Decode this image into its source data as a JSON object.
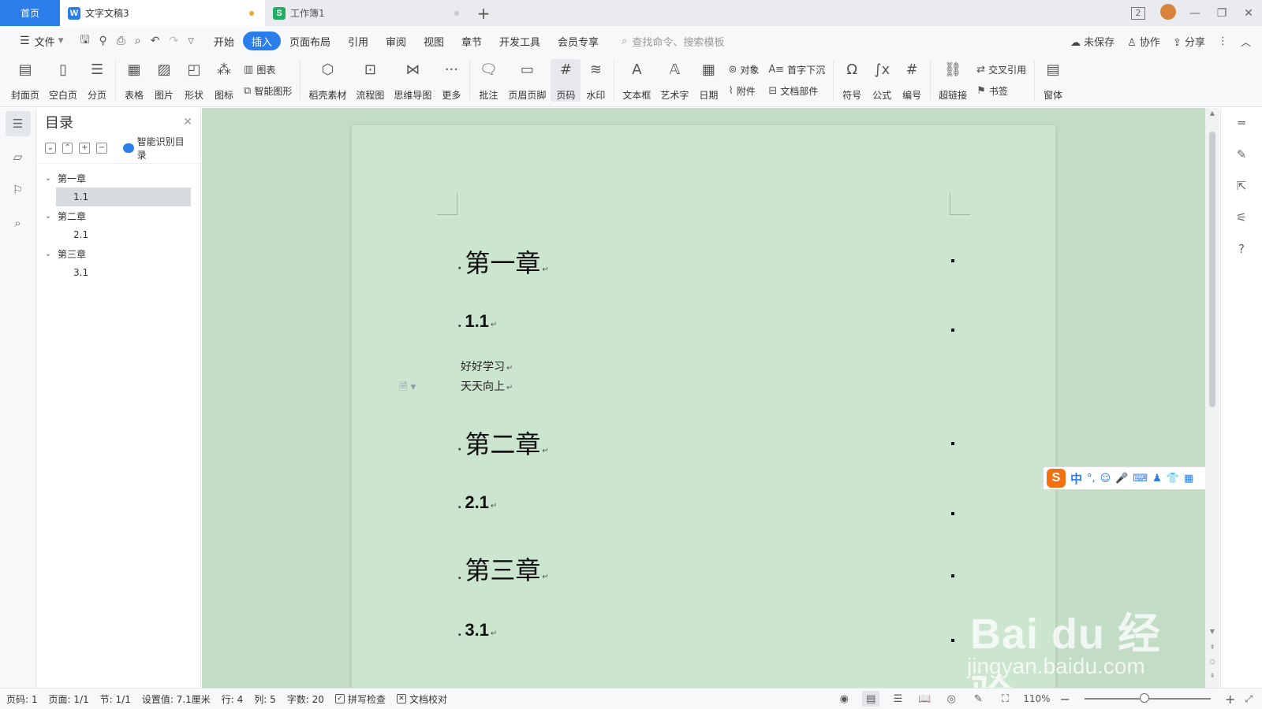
{
  "tabbar": {
    "home_label": "首页",
    "tabs": [
      {
        "title": "文字文稿3",
        "app_letter": "W",
        "app_color": "#2b7de9",
        "active": true,
        "dot_color": "#f4a62a"
      },
      {
        "title": "工作簿1",
        "app_letter": "S",
        "app_color": "#1fae63",
        "active": false,
        "dot_color": "#c8cbd0"
      }
    ],
    "new_tab": "+",
    "badge": "2"
  },
  "menubar": {
    "file_label": "文件",
    "items": [
      "开始",
      "插入",
      "页面布局",
      "引用",
      "审阅",
      "视图",
      "章节",
      "开发工具",
      "会员专享"
    ],
    "active_item": "插入",
    "search_placeholder": "查找命令、搜索模板",
    "right": {
      "unsaved": "未保存",
      "collab": "协作",
      "share": "分享"
    }
  },
  "ribbon": {
    "big": [
      {
        "label": "封面页",
        "icon": "cover-page-icon"
      },
      {
        "label": "空白页",
        "icon": "blank-page-icon"
      },
      {
        "label": "分页",
        "icon": "page-break-icon"
      },
      {
        "label": "表格",
        "icon": "table-icon"
      },
      {
        "label": "图片",
        "icon": "picture-icon"
      },
      {
        "label": "形状",
        "icon": "shape-icon"
      },
      {
        "label": "图标",
        "icon": "icons-icon"
      }
    ],
    "pair1": {
      "top": "图表",
      "bottom": "智能图形"
    },
    "big2": [
      {
        "label": "稻壳素材",
        "icon": "material-icon"
      },
      {
        "label": "流程图",
        "icon": "flowchart-icon"
      },
      {
        "label": "思维导图",
        "icon": "mindmap-icon"
      },
      {
        "label": "更多",
        "icon": "more-icon"
      },
      {
        "label": "批注",
        "icon": "comment-icon"
      },
      {
        "label": "页眉页脚",
        "icon": "header-footer-icon"
      },
      {
        "label": "页码",
        "icon": "page-number-icon"
      },
      {
        "label": "水印",
        "icon": "watermark-icon"
      },
      {
        "label": "文本框",
        "icon": "textbox-icon"
      },
      {
        "label": "艺术字",
        "icon": "wordart-icon"
      },
      {
        "label": "日期",
        "icon": "date-icon"
      }
    ],
    "pair2": {
      "top": "对象",
      "bottom": "附件"
    },
    "pair3": {
      "top": "首字下沉",
      "bottom": "文档部件"
    },
    "big3": [
      {
        "label": "符号",
        "icon": "symbol-icon"
      },
      {
        "label": "公式",
        "icon": "formula-icon"
      },
      {
        "label": "编号",
        "icon": "numbering-icon"
      },
      {
        "label": "超链接",
        "icon": "hyperlink-icon"
      }
    ],
    "pair4": {
      "top": "交叉引用",
      "bottom": "书签"
    },
    "last": {
      "label": "窗体",
      "icon": "form-icon"
    }
  },
  "toc": {
    "title": "目录",
    "smart_label": "智能识别目录",
    "items": [
      {
        "label": "第一章",
        "level": 1
      },
      {
        "label": "1.1",
        "level": 2,
        "selected": true
      },
      {
        "label": "第二章",
        "level": 1
      },
      {
        "label": "2.1",
        "level": 2
      },
      {
        "label": "第三章",
        "level": 1
      },
      {
        "label": "3.1",
        "level": 2
      }
    ]
  },
  "document": {
    "chapter1": "第一章",
    "sec11": "1.1",
    "body1": "好好学习",
    "body2": "天天向上",
    "chapter2": "第二章",
    "sec21": "2.1",
    "chapter3": "第三章",
    "sec31": "3.1",
    "return_mark": "↵",
    "bg_color": "#cce5cf"
  },
  "ime": {
    "logo": "S",
    "mode": "中"
  },
  "status": {
    "page_num": "页码: 1",
    "pages": "页面: 1/1",
    "section": "节: 1/1",
    "setting": "设置值: 7.1厘米",
    "row": "行: 4",
    "col": "列: 5",
    "words": "字数: 20",
    "spell": "拼写检查",
    "proof": "文档校对",
    "zoom": "110%"
  },
  "watermark": {
    "big": "Bai du 经验",
    "small": "jingyan.baidu.com"
  }
}
